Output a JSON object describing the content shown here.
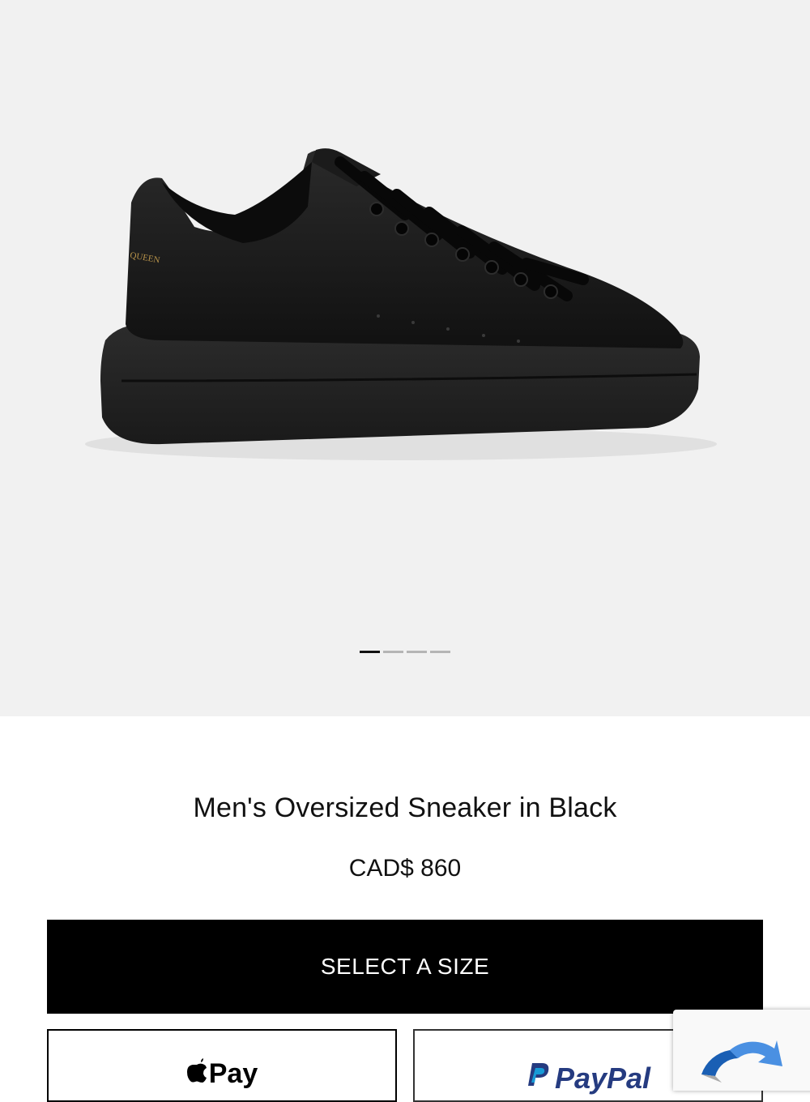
{
  "product": {
    "image": {
      "icon": "sneaker-product-image",
      "alt": "Men's Oversized Sneaker in Black",
      "gallery_total": 4,
      "gallery_active_index": 0
    },
    "title": "Men's Oversized Sneaker in Black",
    "price": "CAD$ 860"
  },
  "actions": {
    "select_size_label": "SELECT A SIZE",
    "apple_pay_label": "Pay",
    "paypal_label": "PayPal"
  },
  "recaptcha": {
    "icon": "recaptcha-icon"
  },
  "colors": {
    "hero_bg": "#f1f1f1",
    "primary_button": "#000000",
    "paypal_blue": "#253b80",
    "paypal_light_blue": "#179bd7",
    "recaptcha_blue": "#4a90e2"
  }
}
